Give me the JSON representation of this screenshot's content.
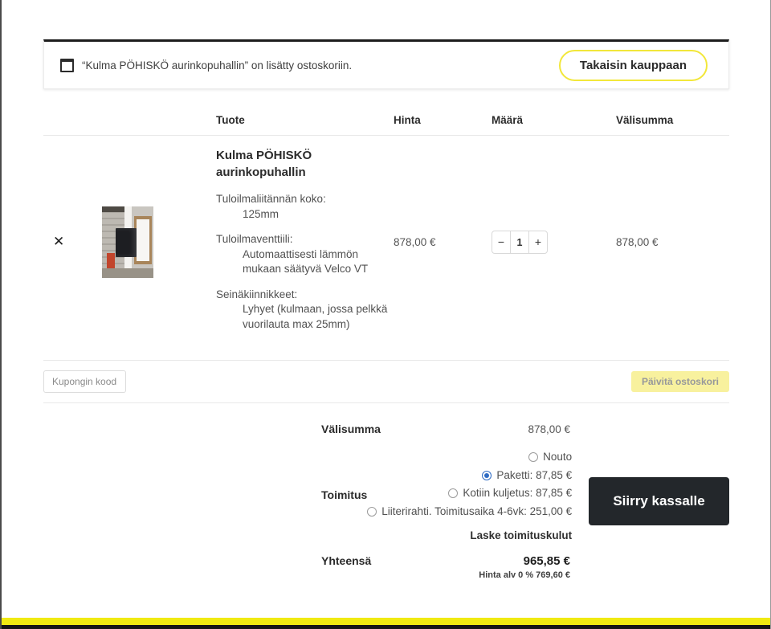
{
  "notice": {
    "message": "“Kulma PÖHISKÖ aurinkopuhallin” on lisätty ostoskoriin.",
    "back_button": "Takaisin kauppaan"
  },
  "cart_table": {
    "headers": {
      "product": "Tuote",
      "price": "Hinta",
      "quantity": "Määrä",
      "subtotal": "Välisumma"
    },
    "item": {
      "remove": "✕",
      "name": "Kulma PÖHISKÖ aurinkopuhallin",
      "attributes": [
        {
          "label": "Tuloilmaliitännän koko:",
          "value": "125mm"
        },
        {
          "label": "Tuloilmaventtiili:",
          "value": "Automaattisesti lämmön mukaan säätyvä Velco VT"
        },
        {
          "label": "Seinäkiinnikkeet:",
          "value": "Lyhyet (kulmaan, jossa pelkkä vuorilauta max 25mm)"
        }
      ],
      "price": "878,00 €",
      "qty_minus": "−",
      "quantity": "1",
      "qty_plus": "+",
      "subtotal": "878,00 €"
    }
  },
  "coupon": {
    "placeholder": "Kupongin koodi",
    "update_button": "Päivitä ostoskori"
  },
  "totals": {
    "subtotal_label": "Välisumma",
    "subtotal_value": "878,00 €",
    "shipping_label": "Toimitus",
    "shipping_options": [
      {
        "label": "Nouto",
        "selected": false
      },
      {
        "label": "Paketti: 87,85 €",
        "selected": true
      },
      {
        "label": "Kotiin kuljetus: 87,85 €",
        "selected": false
      },
      {
        "label": "Liiterirahti. Toimitusaika 4-6vk: 251,00 €",
        "selected": false
      }
    ],
    "calculate_shipping": "Laske toimituskulut",
    "total_label": "Yhteensä",
    "total_value": "965,85 €",
    "tax_note": "Hinta alv 0 % 769,60 €",
    "checkout_button": "Siirry kassalle"
  },
  "colors": {
    "accent_yellow": "#f2e73a",
    "pale_yellow": "#f8f19e",
    "dark_button": "#23272b",
    "radio_selected": "#2e6bc4",
    "bottom_strip_yellow": "#f0ea12"
  }
}
